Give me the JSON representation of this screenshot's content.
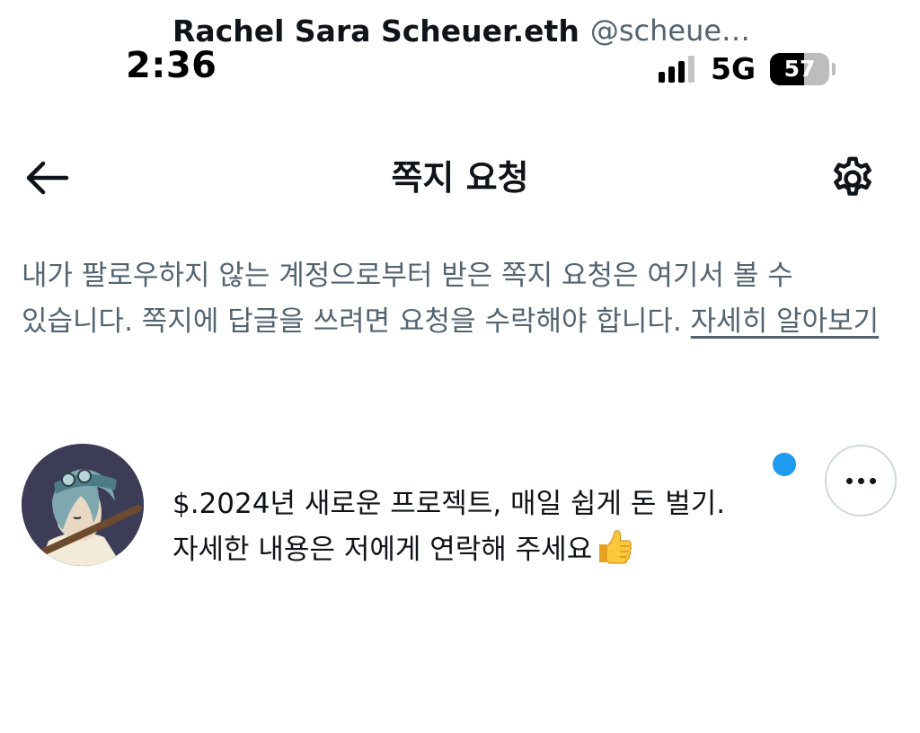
{
  "status_bar": {
    "time": "2:36",
    "network": "5G",
    "battery_level": "57",
    "battery_fraction": 0.57,
    "signal_bars_active": 3,
    "signal_bars_total": 4
  },
  "header": {
    "title": "쪽지 요청",
    "back_icon": "arrow-left-icon",
    "settings_icon": "gear-icon"
  },
  "description": {
    "text": "내가 팔로우하지 않는 계정으로부터 받은 쪽지 요청은 여기서 볼 수 있습니다. 쪽지에 답글을 쓰려면 요청을 수락해야 합니다.",
    "link_label": "자세히 알아보기"
  },
  "requests": [
    {
      "name": "Rachel Sara Scheuer.eth",
      "handle": "@scheuer...",
      "unread": true,
      "message_line1": "$.2024년 새로운 프로젝트, 매일 쉽게 돈 벌기.",
      "message_line2": "자세한 내용은 저에게 연락해 주세요",
      "message_emoji": "thumbs-up-icon"
    }
  ],
  "colors": {
    "text_primary": "#0f1419",
    "text_secondary": "#536471",
    "accent_blue": "#1d9bf0",
    "border": "#cfd9de"
  }
}
